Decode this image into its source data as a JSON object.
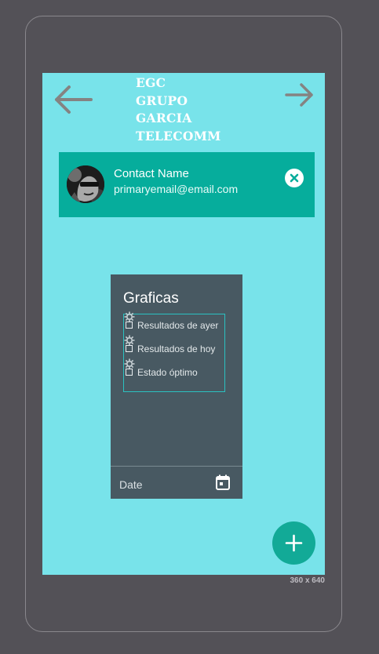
{
  "app": {
    "brand_lines": [
      "EGC",
      "GRUPO",
      "GARCIA",
      "TELECOMM"
    ],
    "device_size_label": "360 x 640"
  },
  "nav": {
    "back_icon": "arrow-left-icon",
    "forward_icon": "arrow-right-icon"
  },
  "contact": {
    "name": "Contact Name",
    "email": "primaryemail@email.com",
    "close_icon": "close-circle-icon"
  },
  "panel": {
    "title": "Graficas",
    "options": [
      {
        "label": "Resultados de ayer",
        "checked": false,
        "icon": "gear-icon"
      },
      {
        "label": "Resultados de hoy",
        "checked": false,
        "icon": "gear-icon"
      },
      {
        "label": "Estado óptimo",
        "checked": false,
        "icon": "gear-icon"
      }
    ],
    "date_label": "Date",
    "calendar_icon": "calendar-icon"
  },
  "fab": {
    "icon": "plus-icon"
  },
  "colors": {
    "screen_bg": "#78e3ea",
    "contact_card": "#06ad9c",
    "panel_bg": "#485962",
    "fab": "#12aa97",
    "outer_bg": "#535157"
  }
}
